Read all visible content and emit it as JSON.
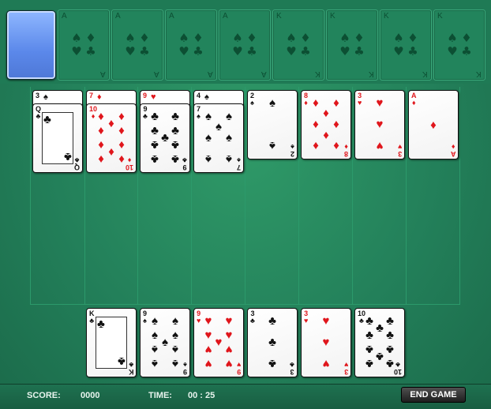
{
  "colors": {
    "felt": "#23805a",
    "red_suit": "#e0161c",
    "black_suit": "#111111",
    "deck_back": "#5b88ea"
  },
  "foundations": [
    {
      "label": "A"
    },
    {
      "label": "A"
    },
    {
      "label": "A"
    },
    {
      "label": "A"
    },
    {
      "label": "K"
    },
    {
      "label": "K"
    },
    {
      "label": "K"
    },
    {
      "label": "K"
    }
  ],
  "tableau": [
    {
      "peek": {
        "rank": "3",
        "suit": "♠"
      },
      "card": {
        "rank": "Q",
        "suit": "♣",
        "face": true
      }
    },
    {
      "peek": {
        "rank": "7",
        "suit": "♦"
      },
      "card": {
        "rank": "10",
        "suit": "♦"
      }
    },
    {
      "peek": {
        "rank": "9",
        "suit": "♥"
      },
      "card": {
        "rank": "9",
        "suit": "♣"
      }
    },
    {
      "peek": {
        "rank": "4",
        "suit": "♠"
      },
      "card": {
        "rank": "7",
        "suit": "♠"
      }
    },
    {
      "card": {
        "rank": "2",
        "suit": "♠"
      }
    },
    {
      "card": {
        "rank": "8",
        "suit": "♦"
      }
    },
    {
      "card": {
        "rank": "3",
        "suit": "♥"
      }
    },
    {
      "card": {
        "rank": "A",
        "suit": "♦"
      }
    }
  ],
  "reserve": [
    {
      "rank": "K",
      "suit": "♣",
      "face": true
    },
    {
      "rank": "9",
      "suit": "♠"
    },
    {
      "rank": "9",
      "suit": "♥"
    },
    {
      "rank": "3",
      "suit": "♣"
    },
    {
      "rank": "3",
      "suit": "♥"
    },
    {
      "rank": "10",
      "suit": "♣"
    }
  ],
  "footer": {
    "score_label": "SCORE:",
    "score_value": "0000",
    "time_label": "TIME:",
    "time_value": "00 : 25",
    "end_game_label": "END GAME"
  }
}
